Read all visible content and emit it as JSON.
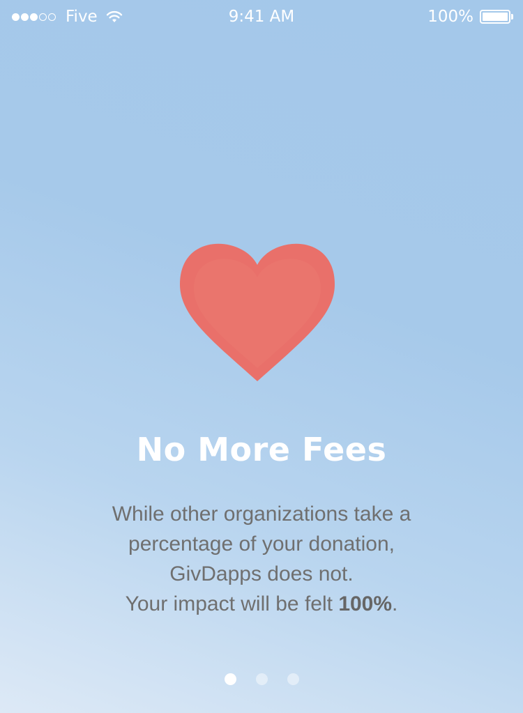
{
  "status_bar": {
    "signal_bars_filled": 3,
    "signal_bars_total": 5,
    "carrier": "Five",
    "wifi_icon": "wifi-icon",
    "time": "9:41 AM",
    "battery_text": "100%",
    "battery_level": 1.0
  },
  "hero": {
    "icon": "heart-icon",
    "icon_color": "#e97169"
  },
  "title": "No More Fees",
  "body": {
    "line1": "While other organizations take a",
    "line2": "percentage of your donation,",
    "line3": "GivDapps does not.",
    "line4_prefix": "Your impact will be felt ",
    "line4_bold": "100%",
    "line4_suffix": "."
  },
  "pager": {
    "page_count": 3,
    "active_index": 0
  },
  "colors": {
    "background_top": "#a4c8ea",
    "background_bottom": "#dde9f6",
    "title": "#ffffff",
    "body_text": "#6f6f6f"
  }
}
